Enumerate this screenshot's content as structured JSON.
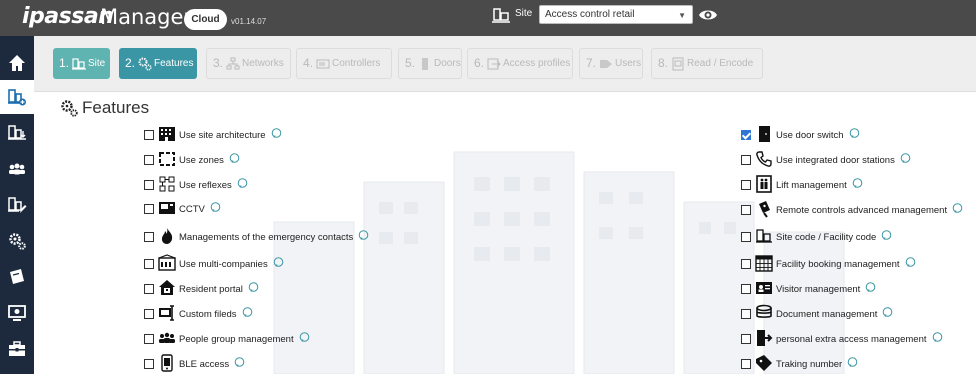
{
  "header": {
    "logo": "ipassan",
    "app_name": "Manager",
    "cloud_badge": "Cloud",
    "version": "v01.14.07",
    "site_label": "Site",
    "site_selected": "Access control retail"
  },
  "sidebar": {
    "items": [
      {
        "icon": "home-icon"
      },
      {
        "icon": "site-icon",
        "active": true
      },
      {
        "icon": "site-download-icon"
      },
      {
        "icon": "users-group-icon"
      },
      {
        "icon": "site-edit-icon"
      },
      {
        "icon": "gears-icon"
      },
      {
        "icon": "card-icon"
      },
      {
        "icon": "monitor-icon"
      },
      {
        "icon": "toolbox-icon"
      }
    ]
  },
  "wizard": {
    "steps": [
      {
        "num": "1.",
        "label": "Site"
      },
      {
        "num": "2.",
        "label": "Features"
      },
      {
        "num": "3.",
        "label": "Networks"
      },
      {
        "num": "4.",
        "label": "Controllers"
      },
      {
        "num": "5.",
        "label": "Doors"
      },
      {
        "num": "6.",
        "label": "Access profiles"
      },
      {
        "num": "7.",
        "label": "Users"
      },
      {
        "num": "8.",
        "label": "Read / Encode"
      }
    ]
  },
  "section_title": "Features",
  "features_left": [
    {
      "label": "Use site architecture",
      "checked": false,
      "icon": "building-icon"
    },
    {
      "label": "Use zones",
      "checked": false,
      "icon": "zone-icon"
    },
    {
      "label": "Use reflexes",
      "checked": false,
      "icon": "reflex-icon"
    },
    {
      "label": "CCTV",
      "checked": false,
      "icon": "cctv-icon"
    },
    {
      "label": "Managements of the emergency contacts",
      "checked": false,
      "icon": "fire-icon"
    },
    {
      "label": "Use multi-companies",
      "checked": false,
      "icon": "multi-company-icon"
    },
    {
      "label": "Resident portal",
      "checked": false,
      "icon": "house-icon"
    },
    {
      "label": "Custom fileds",
      "checked": false,
      "icon": "custom-fields-icon"
    },
    {
      "label": "People group management",
      "checked": false,
      "icon": "people-group-icon"
    },
    {
      "label": "BLE access",
      "checked": false,
      "icon": "ble-icon"
    }
  ],
  "features_right": [
    {
      "label": "Use door switch",
      "checked": true,
      "icon": "door-icon"
    },
    {
      "label": "Use integrated door stations",
      "checked": false,
      "icon": "phone-icon"
    },
    {
      "label": "Lift management",
      "checked": false,
      "icon": "lift-icon"
    },
    {
      "label": "Remote controls advanced management",
      "checked": false,
      "icon": "remote-icon"
    },
    {
      "label": "Site code / Facility code",
      "checked": false,
      "icon": "site-code-icon"
    },
    {
      "label": "Facility booking management",
      "checked": false,
      "icon": "calendar-icon"
    },
    {
      "label": "Visitor management",
      "checked": false,
      "icon": "visitor-icon"
    },
    {
      "label": "Document management",
      "checked": false,
      "icon": "document-icon"
    },
    {
      "label": "personal extra access management",
      "checked": false,
      "icon": "extra-access-icon"
    },
    {
      "label": "Traking number",
      "checked": false,
      "icon": "tag-icon"
    }
  ],
  "colors": {
    "header_bg": "#4a4a4a",
    "sidebar_bg": "#1d2a3e",
    "step_done": "#5fb3b0",
    "step_current": "#3a96a4",
    "checkbox_checked": "#2f76d2"
  }
}
